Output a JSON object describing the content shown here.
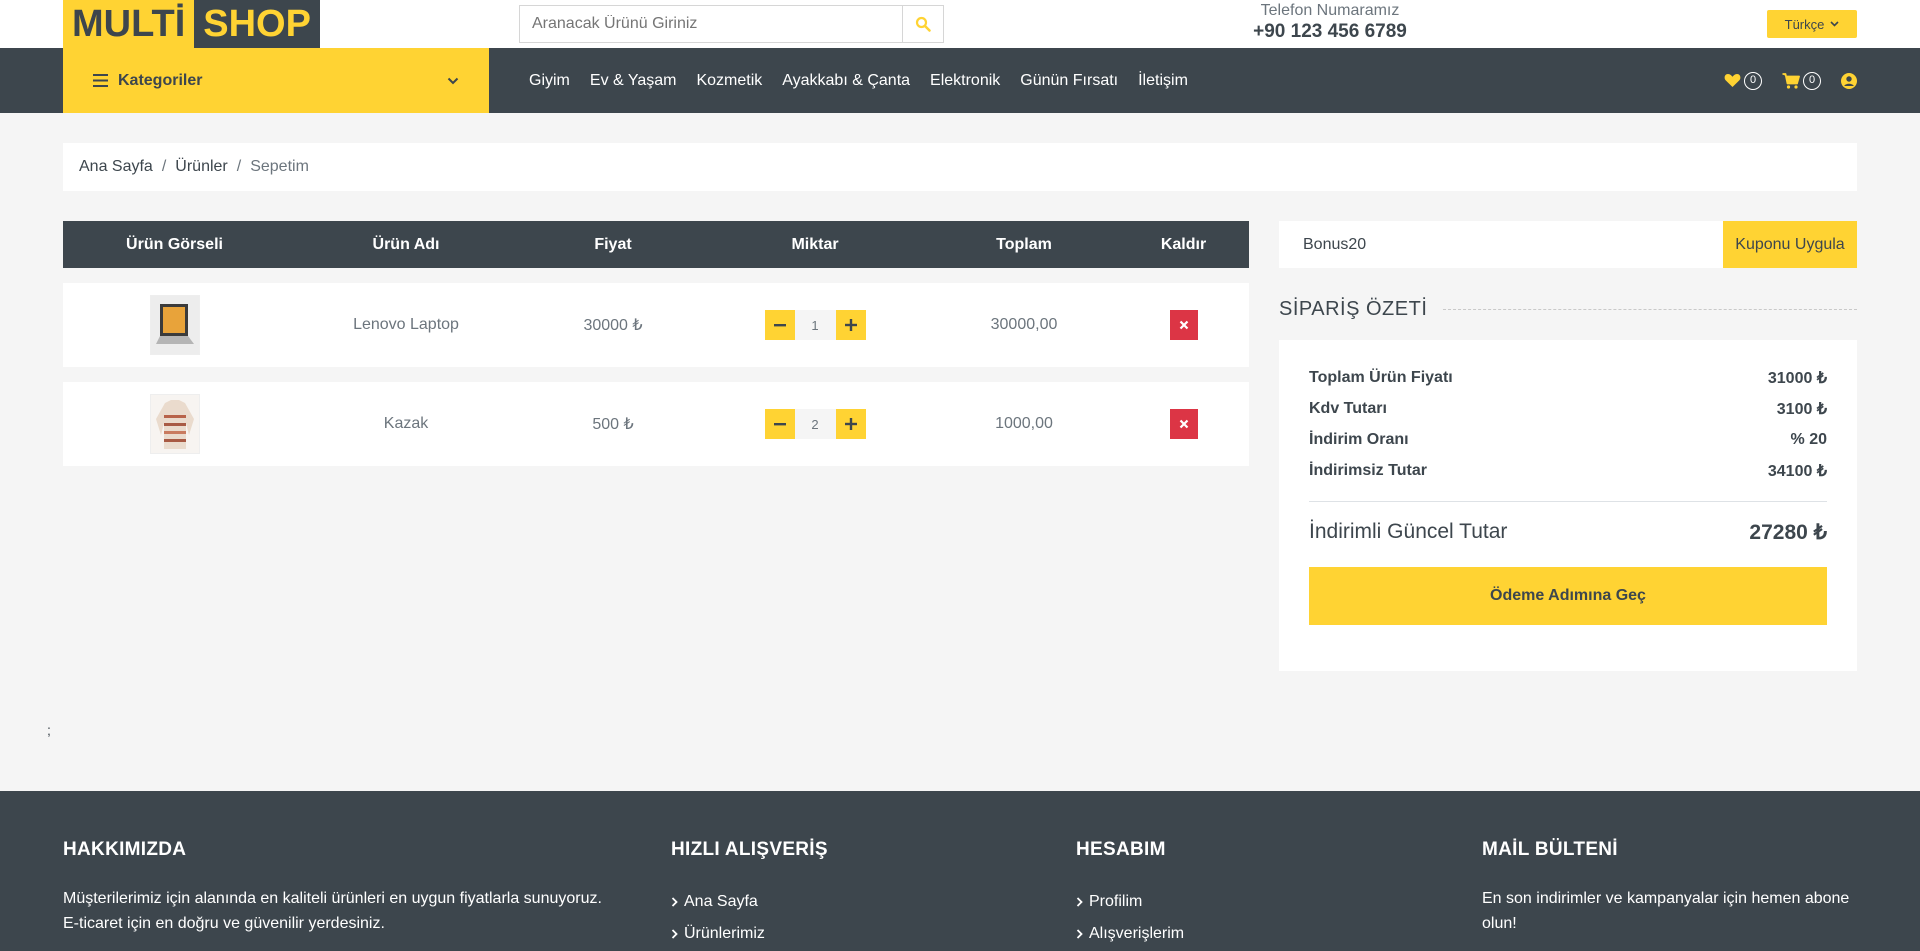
{
  "header": {
    "logo_part1": "MULTİ",
    "logo_part2": "SHOP",
    "search_placeholder": "Aranacak Ürünü Giriniz",
    "phone_label": "Telefon Numaramız",
    "phone_number": "+90 123 456 6789",
    "language": "Türkçe"
  },
  "nav": {
    "categories_label": "Kategoriler",
    "links": [
      "Giyim",
      "Ev & Yaşam",
      "Kozmetik",
      "Ayakkabı & Çanta",
      "Elektronik",
      "Günün Fırsatı",
      "İletişim"
    ],
    "wishlist_count": "0",
    "cart_count": "0"
  },
  "breadcrumb": {
    "items": [
      "Ana Sayfa",
      "Ürünler",
      "Sepetim"
    ]
  },
  "cart": {
    "headers": [
      "Ürün Görseli",
      "Ürün Adı",
      "Fiyat",
      "Miktar",
      "Toplam",
      "Kaldır"
    ],
    "rows": [
      {
        "name": "Lenovo Laptop",
        "price": "30000 ₺",
        "qty": "1",
        "total": "30000,00"
      },
      {
        "name": "Kazak",
        "price": "500 ₺",
        "qty": "2",
        "total": "1000,00"
      }
    ]
  },
  "coupon": {
    "value": "Bonus20",
    "button": "Kuponu Uygula"
  },
  "summary": {
    "title": "SİPARİŞ ÖZETİ",
    "rows": [
      {
        "label": "Toplam Ürün Fiyatı",
        "value": "31000 ₺"
      },
      {
        "label": "Kdv Tutarı",
        "value": "3100 ₺"
      },
      {
        "label": "İndirim Oranı",
        "value": "% 20"
      },
      {
        "label": "İndirimsiz Tutar",
        "value": "34100 ₺"
      }
    ],
    "total_label": "İndirimli Güncel Tutar",
    "total_value": "27280 ₺",
    "pay_button": "Ödeme Adımına Geç"
  },
  "stray_text": ";",
  "footer": {
    "about_title": "HAKKIMIZDA",
    "about_text_1": "Müşterilerimiz için alanında en kaliteli ürünleri en uygun fiyatlarla sunuyoruz.",
    "about_text_2": "E-ticaret için en doğru ve güvenilir yerdesiniz.",
    "quick_title": "HIZLI ALIŞVERİŞ",
    "quick_links": [
      "Ana Sayfa",
      "Ürünlerimiz"
    ],
    "account_title": "HESABIM",
    "account_links": [
      "Profilim",
      "Alışverişlerim"
    ],
    "newsletter_title": "MAİL BÜLTENİ",
    "newsletter_text_1": "En son indirimler ve kampanyalar için hemen abone",
    "newsletter_text_2": "olun!"
  },
  "colors": {
    "accent": "#ffd333",
    "dark": "#3d464d",
    "danger": "#dc3545"
  }
}
